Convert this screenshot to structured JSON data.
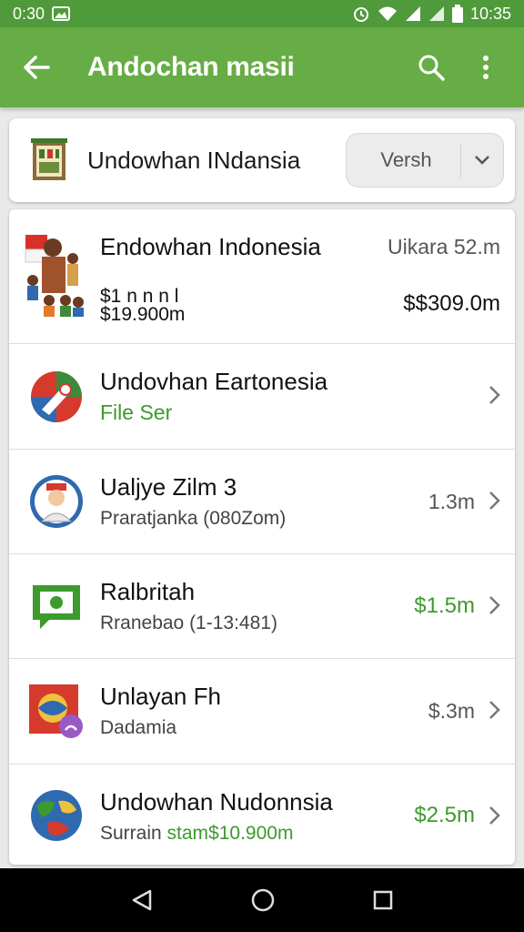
{
  "status_bar": {
    "time_left": "0:30",
    "time_right": "10:35"
  },
  "app_bar": {
    "title": "Andochan masii"
  },
  "filter": {
    "title": "Undowhan INdansia",
    "select_value": "Versh"
  },
  "featured": {
    "name": "Endowhan Indonesia",
    "right_top": "Uikara 52.m",
    "sub_line1": "$1 n n n l",
    "sub_line2": "$19.900m",
    "amount": "$$309.0m"
  },
  "rows": [
    {
      "name": "Undovhan Eartonesia",
      "sub": "File Ser",
      "amount": "",
      "sub_color": "#3d9a2c"
    },
    {
      "name": "Ualjye Zilm 3",
      "sub": "Praratjanka (080Zom)",
      "amount": "1.3m",
      "amount_color": "#555555"
    },
    {
      "name": "Ralbritah",
      "sub": "Rranebao (1-13:481)",
      "amount": "$1.5m",
      "amount_color": "#3d9a2c"
    },
    {
      "name": "Unlayan Fh",
      "sub": "Dadamia",
      "amount": "$.3m",
      "amount_color": "#555555"
    },
    {
      "name": "Undowhan Nudonnsia",
      "sub_prefix": "Surrain",
      "sub_green": "stam$10.900m",
      "amount": "$2.5m",
      "amount_color": "#3d9a2c"
    }
  ],
  "icons": {
    "back": "arrow-left-icon",
    "search": "search-icon",
    "more": "more-vert-icon",
    "select": "chevron-down-icon",
    "row": "chevron-right-icon",
    "nav": [
      "back-triangle-icon",
      "home-circle-icon",
      "recents-square-icon"
    ]
  },
  "colors": {
    "status_bar": "#4f9a3a",
    "app_bar": "#66ad45",
    "accent_green": "#3d9a2c"
  }
}
